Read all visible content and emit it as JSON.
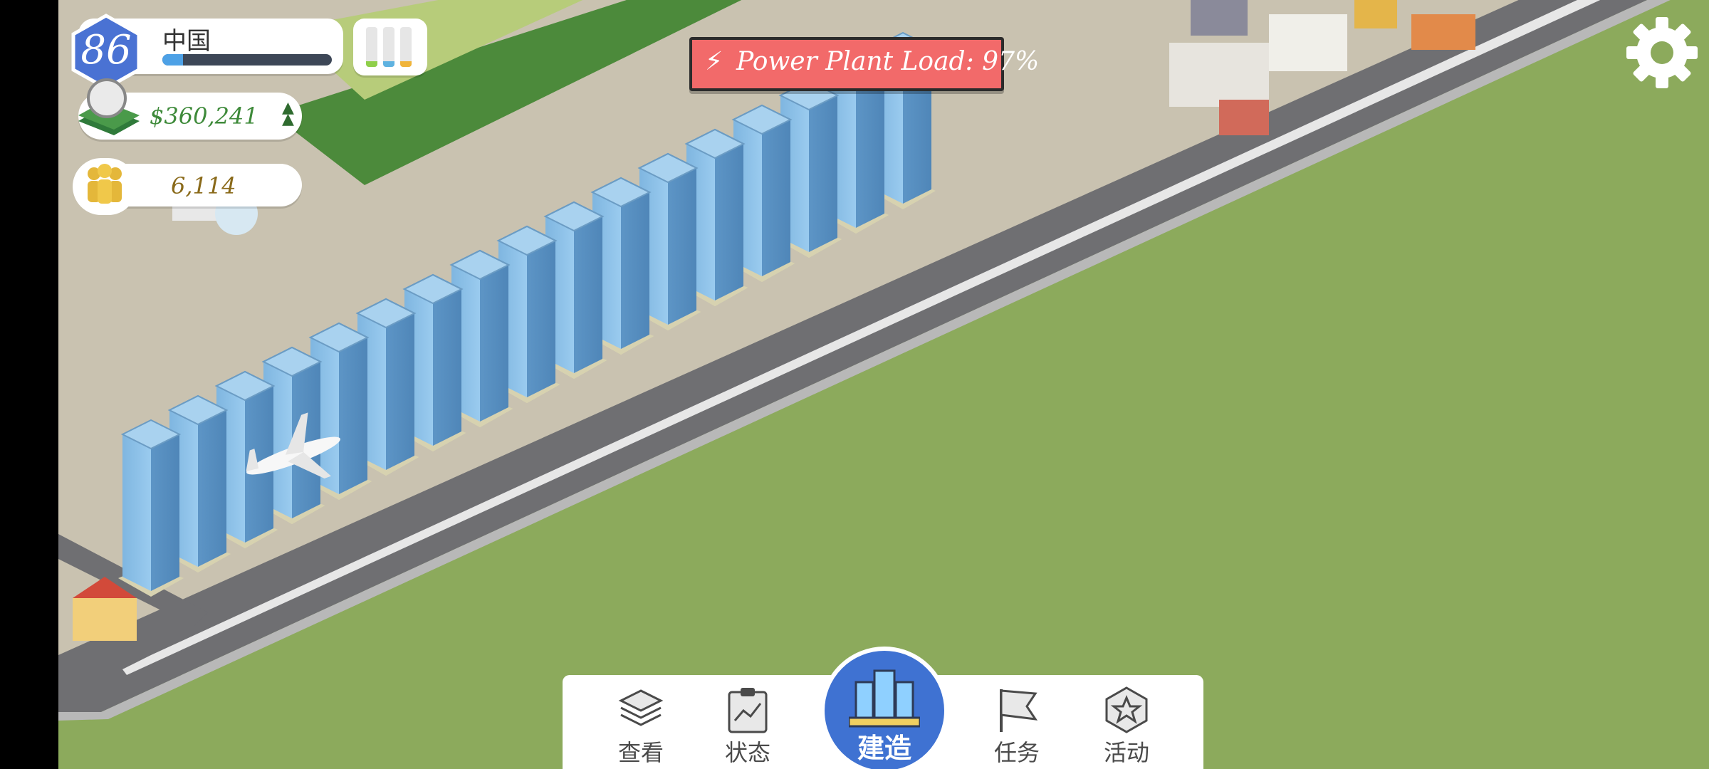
{
  "hud": {
    "level": "86",
    "city_name": "中国",
    "level_progress": 0.12,
    "money": "$360,241",
    "population": "6,114",
    "power_banner": "Power Plant Load: 97%",
    "demand_bars": [
      {
        "name": "residential",
        "color": "#8fcf4a",
        "fill": 0.15
      },
      {
        "name": "commercial",
        "color": "#5fb2e0",
        "fill": 0.15
      },
      {
        "name": "industrial",
        "color": "#f0b43a",
        "fill": 0.15
      }
    ]
  },
  "icons": {
    "settings": "gear-icon",
    "power": "lightning-icon",
    "population": "people-icon",
    "money": "cash-icon"
  },
  "colors": {
    "grass": "#8caa5c",
    "banner": "#f26a6a",
    "nav_active": "#3f72d2",
    "money_text": "#3e8a3a",
    "population_text": "#8a6a1a"
  },
  "bottom_nav": {
    "items": [
      {
        "id": "view",
        "label": "查看",
        "icon": "layers-icon"
      },
      {
        "id": "status",
        "label": "状态",
        "icon": "clipboard-chart-icon"
      },
      {
        "id": "build",
        "label": "建造",
        "icon": "building-icon",
        "active": true
      },
      {
        "id": "missions",
        "label": "任务",
        "icon": "flag-icon"
      },
      {
        "id": "events",
        "label": "活动",
        "icon": "star-badge-icon"
      }
    ]
  }
}
